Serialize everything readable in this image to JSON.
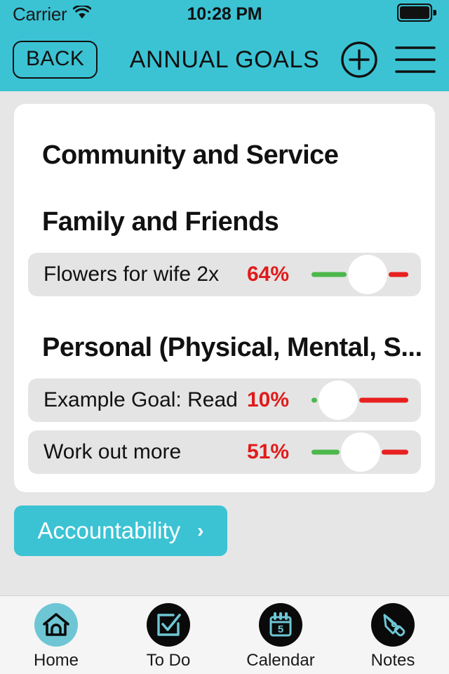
{
  "status_bar": {
    "carrier": "Carrier",
    "wifi_icon": "wifi-icon",
    "time": "10:28 PM",
    "battery_icon": "battery-full-icon"
  },
  "nav_bar": {
    "back_label": "BACK",
    "title": "ANNUAL GOALS",
    "add_icon": "plus-circle-icon",
    "menu_icon": "hamburger-menu-icon"
  },
  "card": {
    "sections": [
      {
        "heading": "Community and Service",
        "goals": []
      },
      {
        "heading": "Family and Friends",
        "goals": [
          {
            "title": "Flowers for wife 2x",
            "percent_label": "64%",
            "percent": 64
          }
        ]
      },
      {
        "heading": "Personal (Physical, Mental, S...",
        "goals": [
          {
            "title": "Example Goal: Read",
            "percent_label": "10%",
            "percent": 10
          },
          {
            "title": "Work out more",
            "percent_label": "51%",
            "percent": 51
          }
        ]
      }
    ]
  },
  "accountability": {
    "label": "Accountability",
    "chevron": "›"
  },
  "tab_bar": {
    "tabs": [
      {
        "label": "Home",
        "icon": "home-icon",
        "active": true
      },
      {
        "label": "To Do",
        "icon": "checkbox-icon",
        "active": false
      },
      {
        "label": "Calendar",
        "icon": "calendar-icon",
        "active": false,
        "badge": "5"
      },
      {
        "label": "Notes",
        "icon": "pen-nib-icon",
        "active": false
      }
    ]
  },
  "colors": {
    "accent": "#3bc3d4",
    "page_bg": "#e6e6e6",
    "card_bg": "#ffffff",
    "row_bg": "#e4e4e4",
    "percent_red": "#e01b1b",
    "track_green": "#4cb84c",
    "track_red": "#e82020"
  }
}
